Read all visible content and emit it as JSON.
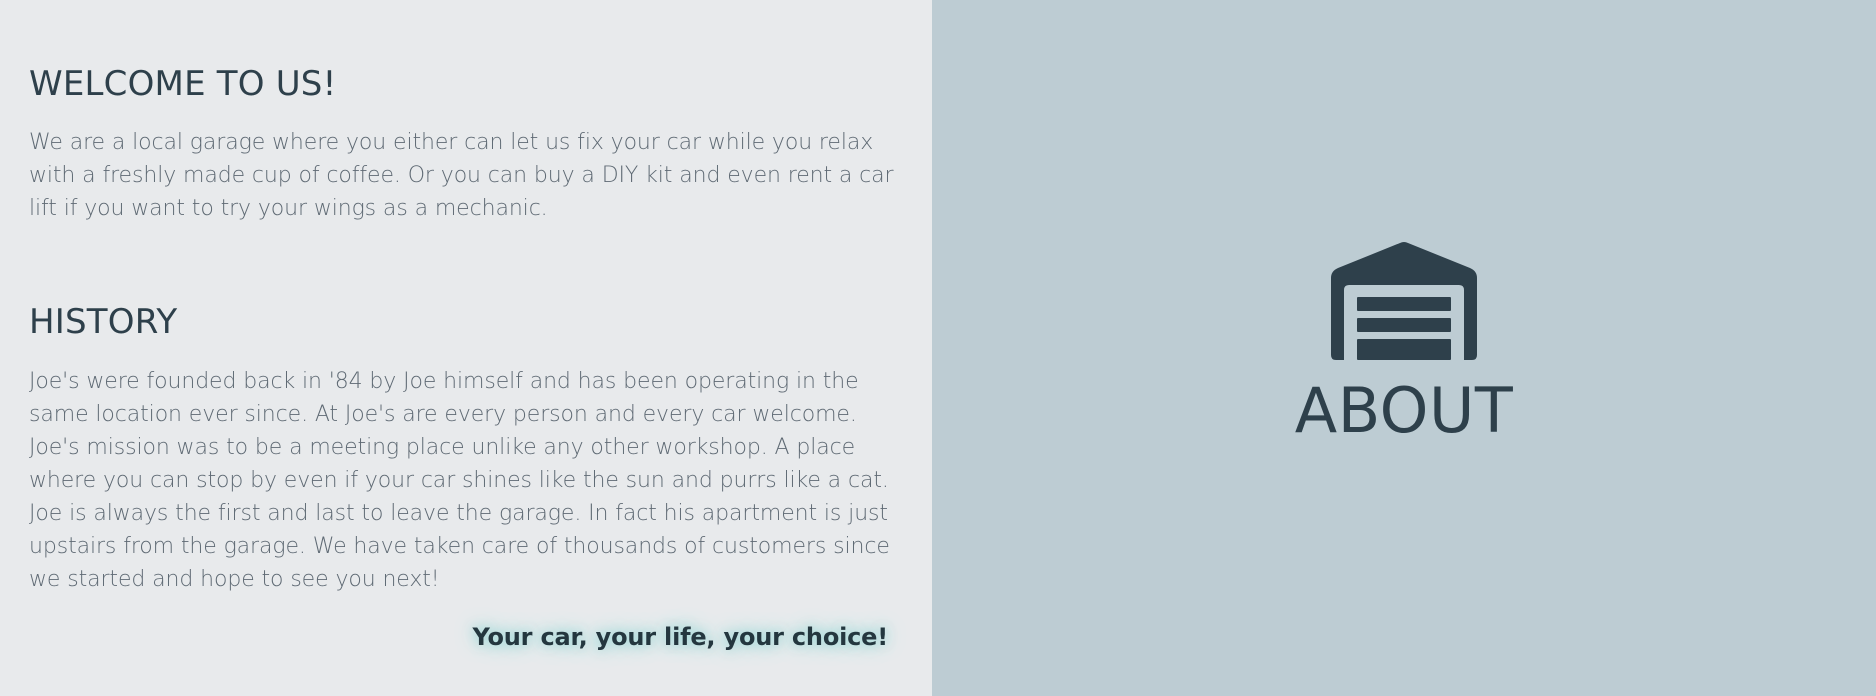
{
  "welcome": {
    "title": "WELCOME TO US!",
    "text": "We are a local garage where you either can let us fix your car while you relax with a freshly made cup of coffee. Or you can buy a DIY kit and even rent a car lift if you want to try your wings as a mechanic."
  },
  "history": {
    "title": "HISTORY",
    "text": "Joe's were founded back in '84 by Joe himself and has been operating in the same location ever since. At Joe's are every person and every car welcome. Joe's mission was to be a meeting place unlike any other workshop. A place where you can stop by even if your car shines like the sun and purrs like a cat. Joe is always the first and last to leave the garage. In fact his apartment is just upstairs from the garage. We have taken care of thousands of customers since we started and hope to see you next!"
  },
  "slogan": "Your car, your life, your choice!",
  "about": {
    "title": "ABOUT",
    "icon": "garage-icon"
  },
  "colors": {
    "left_background": "#e8eaec",
    "right_background": "#bdccd3",
    "heading": "#2e404b",
    "body_text": "#5f6a74",
    "slogan_glow": "#8fd3d2"
  }
}
